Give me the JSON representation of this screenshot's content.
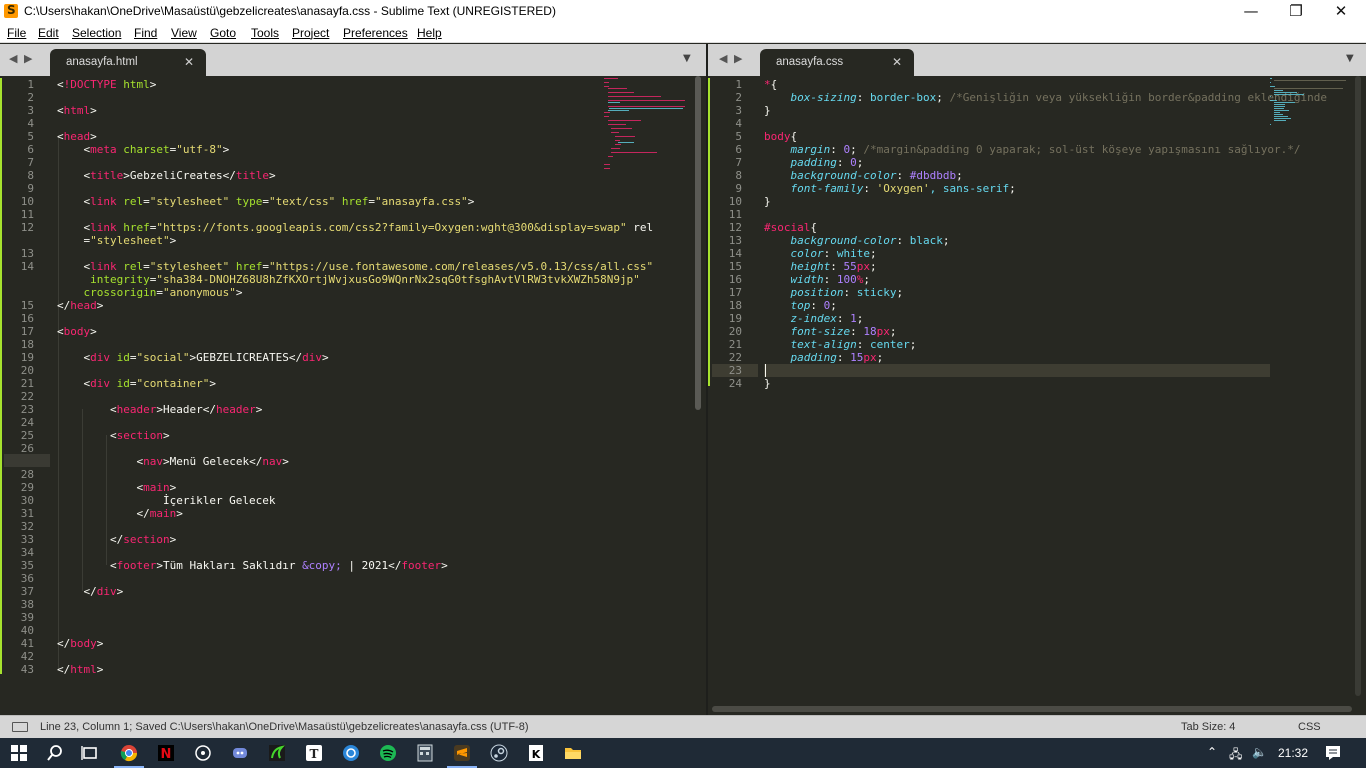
{
  "window": {
    "title": "C:\\Users\\hakan\\OneDrive\\Masaüstü\\gebzelicreates\\anasayfa.css - Sublime Text (UNREGISTERED)",
    "minimize": "—",
    "maximize": "❐",
    "close": "✕"
  },
  "menu": [
    "File",
    "Edit",
    "Selection",
    "Find",
    "View",
    "Goto",
    "Tools",
    "Project",
    "Preferences",
    "Help"
  ],
  "tabs": {
    "nav_prev": "◀",
    "nav_next": "▶",
    "left_label": "anasayfa.html",
    "right_label": "anasayfa.css",
    "close_glyph": "✕",
    "dropdown_glyph": "▼"
  },
  "html_editor": {
    "line_numbers": [
      "1",
      "2",
      "3",
      "4",
      "5",
      "6",
      "7",
      "8",
      "9",
      "10",
      "11",
      "12",
      "",
      "13",
      "14",
      "",
      "",
      "15",
      "16",
      "17",
      "18",
      "19",
      "20",
      "21",
      "22",
      "23",
      "24",
      "25",
      "26",
      "27",
      "28",
      "29",
      "30",
      "31",
      "32",
      "33",
      "34",
      "35",
      "36",
      "37",
      "38",
      "39",
      "40",
      "41",
      "42",
      "43"
    ],
    "lines": [
      "<!DOCTYPE html>",
      "",
      "<html>",
      "",
      "<head>",
      "    <meta charset=\"utf-8\">",
      "",
      "    <title>GebzeliCreates</title>",
      "",
      "    <link rel=\"stylesheet\" type=\"text/css\" href=\"anasayfa.css\">",
      "",
      "    <link href=\"https://fonts.googleapis.com/css2?family=Oxygen:wght@300&display=swap\" rel",
      "    =\"stylesheet\">",
      "",
      "    <link rel=\"stylesheet\" href=\"https://use.fontawesome.com/releases/v5.0.13/css/all.css\"",
      "     integrity=\"sha384-DNOHZ68U8hZfKXOrtjWvjxusGo9WQnrNx2sqG0tfsghAvtVlRW3tvkXWZh58N9jp\"",
      "    crossorigin=\"anonymous\">",
      "</head>",
      "",
      "<body>",
      "",
      "    <div id=\"social\">GEBZELICREATES</div>",
      "",
      "    <div id=\"container\">",
      "",
      "        <header>Header</header>",
      "",
      "        <section>",
      "",
      "            <nav>Menü Gelecek</nav>",
      "",
      "            <main>",
      "                İçerikler Gelecek",
      "            </main>",
      "",
      "        </section>",
      "",
      "        <footer>Tüm Hakları Saklıdır &copy; | 2021</footer>",
      "",
      "    </div>",
      "",
      "",
      "",
      "</body>",
      "",
      "</html>"
    ]
  },
  "css_editor": {
    "line_numbers": [
      "1",
      "2",
      "3",
      "4",
      "5",
      "6",
      "7",
      "8",
      "9",
      "10",
      "11",
      "12",
      "13",
      "14",
      "15",
      "16",
      "17",
      "18",
      "19",
      "20",
      "21",
      "22",
      "23",
      "24"
    ],
    "lines": [
      "*{",
      "    box-sizing: border-box; /*Genişliğin veya yüksekliğin border&padding eklendiğinde",
      "}",
      "",
      "body{",
      "    margin: 0; /*margin&padding 0 yaparak; sol-üst köşeye yapışmasını sağlıyor.*/",
      "    padding: 0;",
      "    background-color: #dbdbdb;",
      "    font-family: 'Oxygen', sans-serif;",
      "}",
      "",
      "#social{",
      "    background-color: black;",
      "    color: white;",
      "    height: 55px;",
      "    width: 100%;",
      "    position: sticky;",
      "    top: 0;",
      "    z-index: 1;",
      "    font-size: 18px;",
      "    text-align: center;",
      "    padding: 15px;",
      "",
      "}"
    ],
    "current_line": 23
  },
  "status": {
    "text": "Line 23, Column 1; Saved C:\\Users\\hakan\\OneDrive\\Masaüstü\\gebzelicreates\\anasayfa.css (UTF-8)",
    "tab_size": "Tab Size: 4",
    "syntax": "CSS"
  },
  "taskbar": {
    "time": "21:32",
    "apps": [
      "windows-start",
      "search",
      "task-view",
      "chrome",
      "netflix",
      "music-app",
      "discord",
      "razer",
      "typora",
      "ubisoft",
      "spotify",
      "calculator",
      "sublime-text",
      "steam",
      "epic-games",
      "file-explorer"
    ]
  },
  "colors": {
    "editor_bg": "#272822",
    "tag": "#f92672",
    "attribute": "#a6e22e",
    "string": "#e6db74",
    "property": "#66d9ef",
    "number": "#ae81ff",
    "comment": "#75715e"
  }
}
